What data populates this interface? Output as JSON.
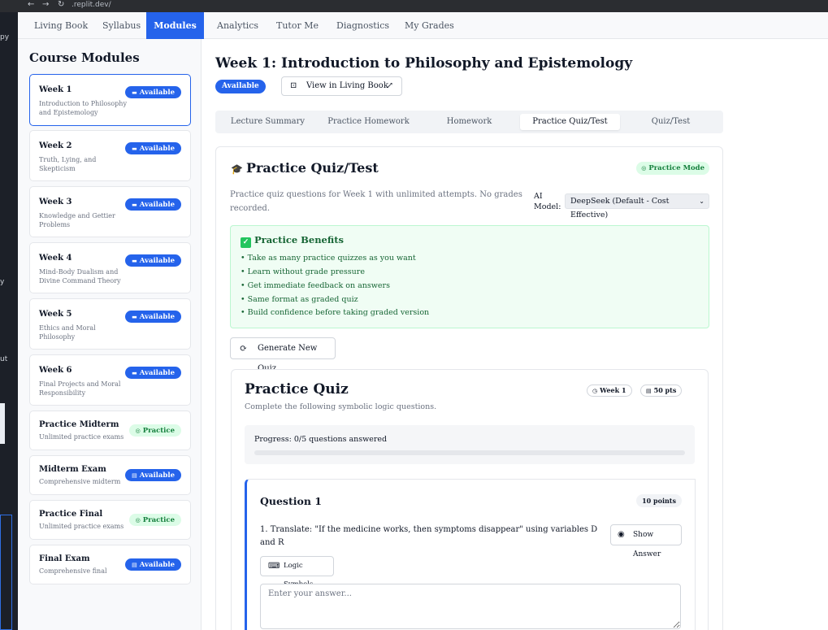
{
  "browser": {
    "url": ".replit.dev/",
    "back_glyph": "←",
    "forward_glyph": "→",
    "reload_glyph": "↻"
  },
  "editor_strip": {
    "fragments": [
      "+",
      "py",
      "y",
      "ut"
    ]
  },
  "topnav": {
    "tabs": [
      {
        "label": "Living Book",
        "active": false
      },
      {
        "label": "Syllabus",
        "active": false
      },
      {
        "label": "Modules",
        "active": true
      },
      {
        "label": "Analytics",
        "active": false
      },
      {
        "label": "Tutor Me",
        "active": false
      },
      {
        "label": "Diagnostics",
        "active": false
      },
      {
        "label": "My Grades",
        "active": false
      }
    ]
  },
  "sidebar": {
    "title": "Course Modules",
    "modules": [
      {
        "title": "Week 1",
        "subtitle": "Introduction to Philosophy and Epistemology",
        "badge": "Available",
        "badge_type": "available",
        "selected": true
      },
      {
        "title": "Week 2",
        "subtitle": "Truth, Lying, and Skepticism",
        "badge": "Available",
        "badge_type": "available"
      },
      {
        "title": "Week 3",
        "subtitle": "Knowledge and Gettier Problems",
        "badge": "Available",
        "badge_type": "available"
      },
      {
        "title": "Week 4",
        "subtitle": "Mind-Body Dualism and Divine Command Theory",
        "badge": "Available",
        "badge_type": "available"
      },
      {
        "title": "Week 5",
        "subtitle": "Ethics and Moral Philosophy",
        "badge": "Available",
        "badge_type": "available"
      },
      {
        "title": "Week 6",
        "subtitle": "Final Projects and Moral Responsibility",
        "badge": "Available",
        "badge_type": "available"
      },
      {
        "title": "Practice Midterm",
        "subtitle": "Unlimited practice exams",
        "badge": "Practice",
        "badge_type": "practice"
      },
      {
        "title": "Midterm Exam",
        "subtitle": "Comprehensive midterm",
        "badge": "Available",
        "badge_type": "available"
      },
      {
        "title": "Practice Final",
        "subtitle": "Unlimited practice exams",
        "badge": "Practice",
        "badge_type": "practice"
      },
      {
        "title": "Final Exam",
        "subtitle": "Comprehensive final",
        "badge": "Available",
        "badge_type": "available"
      }
    ]
  },
  "main": {
    "week_title": "Week 1: Introduction to Philosophy and Epistemology",
    "status_badge": "Available",
    "living_book_button": "View in Living Book",
    "subtabs": [
      {
        "label": "Lecture Summary",
        "active": false
      },
      {
        "label": "Practice Homework",
        "active": false
      },
      {
        "label": "Homework",
        "active": false
      },
      {
        "label": "Practice Quiz/Test",
        "active": true
      },
      {
        "label": "Quiz/Test",
        "active": false
      }
    ],
    "quiz_card": {
      "title": "Practice Quiz/Test",
      "mode_badge": "Practice Mode",
      "description": "Practice quiz questions for Week 1 with unlimited attempts. No grades recorded.",
      "ai_model_label": "AI Model:",
      "ai_model_value": "DeepSeek (Default - Cost Effective)",
      "benefits": {
        "title": "Practice Benefits",
        "items": [
          "• Take as many practice quizzes as you want",
          "• Learn without grade pressure",
          "• Get immediate feedback on answers",
          "• Same format as graded quiz",
          "• Build confidence before taking graded version"
        ]
      },
      "generate_button": "Generate New Quiz"
    },
    "practice_quiz": {
      "title": "Practice Quiz",
      "subtitle": "Complete the following symbolic logic questions.",
      "week_pill": "Week 1",
      "points_pill": "50 pts",
      "progress_text": "Progress: 0/5 questions answered",
      "progress_fraction": 0,
      "question": {
        "title": "Question 1",
        "points": "10 points",
        "text": "1. Translate: \"If the medicine works, then symptoms disappear\" using variables D and R",
        "show_answer_button": "Show Answer",
        "logic_symbols_button": "Logic Symbols",
        "answer_placeholder": "Enter your answer..."
      }
    }
  },
  "colors": {
    "accent": "#2563eb",
    "practice_bg": "#dcfce7",
    "practice_text": "#15803d",
    "benefits_bg": "#f0fdf4"
  }
}
